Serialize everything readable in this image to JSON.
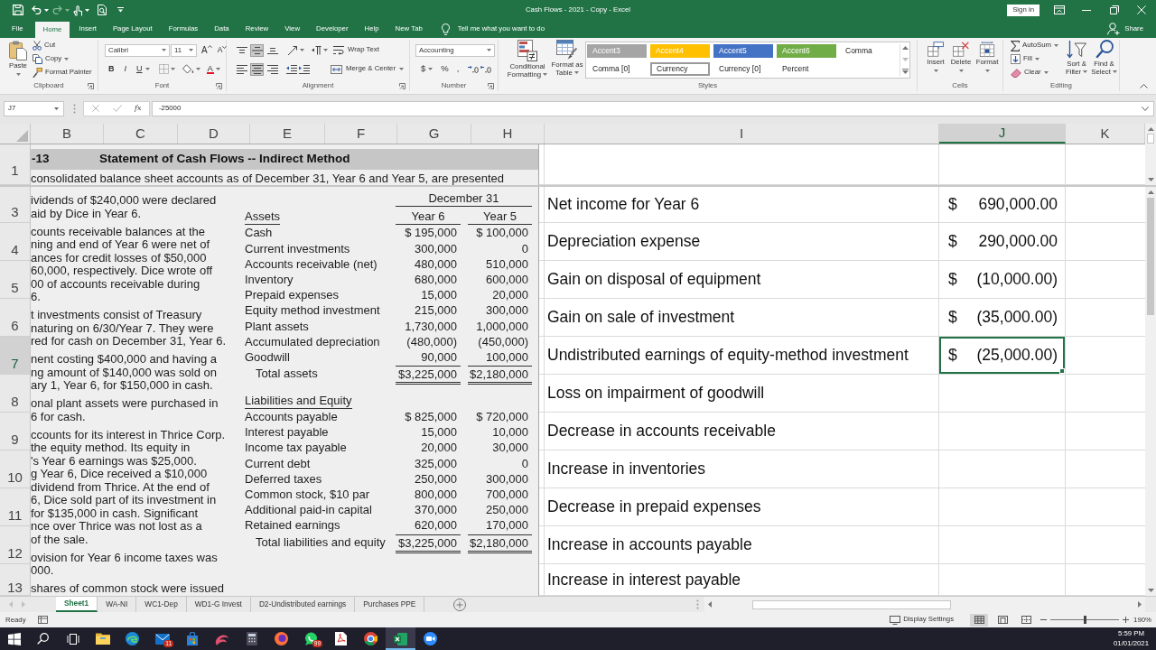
{
  "title_bar": {
    "title": "Cash Flows - 2021 - Copy - Excel",
    "sign_in": "Sign in"
  },
  "quick_access": [
    {
      "kind": "save",
      "disabled": false,
      "dropdown": false
    },
    {
      "kind": "undo",
      "disabled": false,
      "dropdown": true
    },
    {
      "kind": "redo",
      "disabled": true,
      "dropdown": true
    },
    {
      "kind": "touch-mode",
      "disabled": false,
      "dropdown": true
    },
    {
      "kind": "print-preview",
      "disabled": false,
      "dropdown": false
    },
    {
      "kind": "customize",
      "disabled": false,
      "dropdown": false
    }
  ],
  "menu_tabs": [
    {
      "label": "File",
      "selected": false
    },
    {
      "label": "Home",
      "selected": true
    },
    {
      "label": "Insert",
      "selected": false
    },
    {
      "label": "Page Layout",
      "selected": false
    },
    {
      "label": "Formulas",
      "selected": false
    },
    {
      "label": "Data",
      "selected": false
    },
    {
      "label": "Review",
      "selected": false
    },
    {
      "label": "View",
      "selected": false
    },
    {
      "label": "Developer",
      "selected": false
    },
    {
      "label": "Help",
      "selected": false
    },
    {
      "label": "New Tab",
      "selected": false
    }
  ],
  "tell_me": "Tell me what you want to do",
  "share": "Share",
  "ribbon": {
    "clipboard": {
      "label": "Clipboard",
      "paste": "Paste",
      "items": [
        {
          "label": "Cut",
          "kind": "cut",
          "dropdown": false
        },
        {
          "label": "Copy",
          "kind": "copy",
          "dropdown": true
        },
        {
          "label": "Format Painter",
          "kind": "format-painter",
          "dropdown": false
        }
      ]
    },
    "font": {
      "label": "Font",
      "font_name": "Calibri",
      "font_size": "11",
      "grow": "A",
      "shrink": "A",
      "bold": "B",
      "italic": "I",
      "underline": "U",
      "font_color": "A"
    },
    "alignment": {
      "label": "Alignment",
      "vertical": [
        {
          "kind": "top",
          "selected": false
        },
        {
          "kind": "middle",
          "selected": true
        },
        {
          "kind": "bottom",
          "selected": false
        }
      ],
      "horizontal": [
        {
          "kind": "left",
          "selected": false
        },
        {
          "kind": "center",
          "selected": true
        },
        {
          "kind": "right",
          "selected": false
        }
      ],
      "wrap_text": "Wrap Text",
      "merge": "Merge & Center"
    },
    "number": {
      "label": "Number",
      "format": "Accounting",
      "currency": "$",
      "percent": "%",
      "comma": ","
    },
    "styles": {
      "label": "Styles",
      "conditional": "Conditional Formatting",
      "format_table": "Format as Table",
      "cell_styles": [
        {
          "name": "Accent3",
          "color": "#a5a5a5",
          "selected": false
        },
        {
          "name": "Accent4",
          "color": "#ffc000",
          "selected": false
        },
        {
          "name": "Accent5",
          "color": "#4472c4",
          "selected": false
        },
        {
          "name": "Accent6",
          "color": "#70ad47",
          "selected": false
        },
        {
          "name": "Comma",
          "selected": false
        },
        {
          "name": "Comma [0]",
          "selected": false
        },
        {
          "name": "Currency",
          "selected": true
        },
        {
          "name": "Currency [0]",
          "selected": false
        },
        {
          "name": "Percent",
          "selected": false
        }
      ]
    },
    "cells": {
      "label": "Cells",
      "buttons": [
        {
          "label": "Insert",
          "kind": "insert"
        },
        {
          "label": "Delete",
          "kind": "delete"
        },
        {
          "label": "Format",
          "kind": "format"
        }
      ]
    },
    "editing": {
      "label": "Editing",
      "autosum": "AutoSum",
      "fill": "Fill",
      "clear": "Clear",
      "sort": "Sort & Filter",
      "find": "Find & Select"
    }
  },
  "formula_bar": {
    "name_box": "J7",
    "function": "fx",
    "formula": "-25000"
  },
  "columns": [
    {
      "label": "B",
      "selected": false
    },
    {
      "label": "C",
      "selected": false
    },
    {
      "label": "D",
      "selected": false
    },
    {
      "label": "E",
      "selected": false
    },
    {
      "label": "F",
      "selected": false
    },
    {
      "label": "G",
      "selected": false
    },
    {
      "label": "H",
      "selected": false
    },
    {
      "label": "I",
      "selected": false
    },
    {
      "label": "J",
      "selected": true
    },
    {
      "label": "K",
      "selected": false
    }
  ],
  "frozen_rows": [
    {
      "header": "1",
      "selected": false
    }
  ],
  "picture": {
    "number": "-13",
    "title": "Statement of Cash Flows -- Indirect Method",
    "intro": "consolidated balance sheet accounts as of December 31, Year 6 and Year 5, are presented",
    "notes": [
      {
        "lines": [
          "ividends of $240,000 were declared",
          "aid by Dice in Year 6."
        ]
      },
      {
        "lines": [
          "counts receivable balances at the",
          "ning and end of Year 6 were net of",
          "ances for credit losses of $50,000",
          "60,000, respectively. Dice wrote off",
          "00 of accounts receivable during",
          "6."
        ]
      },
      {
        "lines": [
          "t investments consist of Treasury",
          "naturing on 6/30/Year 7. They were",
          "red for cash on December 31, Year 6."
        ]
      },
      {
        "lines": [
          "nent costing $400,000 and having a",
          "ng amount of $140,000 was sold on",
          "ary 1, Year 6, for $150,000 in cash."
        ]
      },
      {
        "lines": [
          "onal plant assets were purchased in",
          "6 for cash."
        ]
      },
      {
        "lines": [
          "ccounts for its interest in Thrice Corp.",
          "the equity method. Its equity in",
          "'s Year 6 earnings was $25,000.",
          "g Year 6, Dice received a $10,000",
          "dividend from Thrice. At the end of",
          "6, Dice sold part of its investment in",
          "for $135,000 in cash. Significant",
          "nce over Thrice was not lost as a",
          "of the sale."
        ]
      },
      {
        "lines": [
          "ovision for Year 6 income taxes was",
          "000."
        ]
      },
      {
        "lines": [
          "shares of common stock were issued"
        ]
      }
    ],
    "balance_sheet": {
      "period": "December 31",
      "years": [
        "Year 6",
        "Year 5"
      ],
      "sections": [
        {
          "heading": "Assets",
          "rows": [
            {
              "label": "Cash",
              "kind": "item",
              "values": [
                "$ 195,000",
                "$ 100,000"
              ]
            },
            {
              "label": "Current investments",
              "kind": "item",
              "values": [
                "300,000",
                "0"
              ]
            },
            {
              "label": "Accounts receivable (net)",
              "kind": "item",
              "values": [
                "480,000",
                "510,000"
              ]
            },
            {
              "label": "Inventory",
              "kind": "item",
              "values": [
                "680,000",
                "600,000"
              ]
            },
            {
              "label": "Prepaid expenses",
              "kind": "item",
              "values": [
                "15,000",
                "20,000"
              ]
            },
            {
              "label": "Equity method investment",
              "kind": "item",
              "values": [
                "215,000",
                "300,000"
              ]
            },
            {
              "label": "Plant assets",
              "kind": "item",
              "values": [
                "1,730,000",
                "1,000,000"
              ]
            },
            {
              "label": "Accumulated depreciation",
              "kind": "item",
              "values": [
                "(480,000)",
                "(450,000)"
              ]
            },
            {
              "label": "Goodwill",
              "kind": "item",
              "values": [
                "90,000",
                "100,000"
              ]
            },
            {
              "label": "Total assets",
              "kind": "total",
              "values": [
                "$3,225,000",
                "$2,180,000"
              ]
            }
          ]
        },
        {
          "heading": "Liabilities and Equity",
          "rows": [
            {
              "label": "Accounts payable",
              "kind": "item",
              "values": [
                "$ 825,000",
                "$ 720,000"
              ]
            },
            {
              "label": "Interest payable",
              "kind": "item",
              "values": [
                "15,000",
                "10,000"
              ]
            },
            {
              "label": "Income tax payable",
              "kind": "item",
              "values": [
                "20,000",
                "30,000"
              ]
            },
            {
              "label": "Current debt",
              "kind": "item",
              "values": [
                "325,000",
                "0"
              ]
            },
            {
              "label": "Deferred taxes",
              "kind": "item",
              "values": [
                "250,000",
                "300,000"
              ]
            },
            {
              "label": "Common stock, $10 par",
              "kind": "item",
              "values": [
                "800,000",
                "700,000"
              ]
            },
            {
              "label": "Additional paid-in capital",
              "kind": "item",
              "values": [
                "370,000",
                "250,000"
              ]
            },
            {
              "label": "Retained earnings",
              "kind": "item",
              "values": [
                "620,000",
                "170,000"
              ]
            },
            {
              "label": "Total liabilities and equity",
              "kind": "total",
              "values": [
                "$3,225,000",
                "$2,180,000"
              ]
            }
          ]
        }
      ]
    }
  },
  "rows": [
    {
      "header": "3",
      "selected": false,
      "item": "Net income for Year 6",
      "currency": "$",
      "amount": "690,000.00"
    },
    {
      "header": "4",
      "selected": false,
      "item": "Depreciation expense",
      "currency": "$",
      "amount": "290,000.00"
    },
    {
      "header": "5",
      "selected": false,
      "item": "Gain on disposal of equipment",
      "currency": "$",
      "amount": "(10,000.00)"
    },
    {
      "header": "6",
      "selected": false,
      "item": "Gain on sale of investment",
      "currency": "$",
      "amount": "(35,000.00)"
    },
    {
      "header": "7",
      "selected": true,
      "item": "Undistributed earnings of equity-method investment",
      "currency": "$",
      "amount": "(25,000.00)"
    },
    {
      "header": "8",
      "selected": false,
      "item": "Loss on impairment of goodwill"
    },
    {
      "header": "9",
      "selected": false,
      "item": "Decrease in accounts receivable"
    },
    {
      "header": "10",
      "selected": false,
      "item": "Increase in inventories"
    },
    {
      "header": "11",
      "selected": false,
      "item": "Decrease in prepaid expenses"
    },
    {
      "header": "12",
      "selected": false,
      "item": "Increase in accounts payable"
    },
    {
      "header": "13",
      "selected": false,
      "item": "Increase in interest payable"
    }
  ],
  "sheet_tabs": [
    {
      "label": "Sheet1",
      "selected": true
    },
    {
      "label": "WA-NI",
      "selected": false
    },
    {
      "label": "WC1-Dep",
      "selected": false
    },
    {
      "label": "WD1-G Invest",
      "selected": false
    },
    {
      "label": "D2-Undistributed earnings",
      "selected": false
    },
    {
      "label": "Purchases PPE",
      "selected": false
    }
  ],
  "status_bar": {
    "status": "Ready",
    "display_settings": "Display Settings",
    "views": [
      {
        "kind": "normal",
        "selected": true
      },
      {
        "kind": "page-layout",
        "selected": false
      },
      {
        "kind": "page-break",
        "selected": false
      }
    ],
    "zoom": {
      "level": 0.5,
      "reading": "190%"
    }
  },
  "taskbar": {
    "apps": [
      {
        "kind": "folder",
        "active": false
      },
      {
        "kind": "browser-wave",
        "active": false
      },
      {
        "kind": "mail",
        "active": false,
        "badge": "11"
      },
      {
        "kind": "shopping-bag",
        "active": false
      },
      {
        "kind": "swirl",
        "active": false
      },
      {
        "kind": "calculator",
        "active": false
      },
      {
        "kind": "browser-fox",
        "active": false
      },
      {
        "kind": "chat",
        "active": false,
        "badge": "99"
      },
      {
        "kind": "pdf",
        "active": false
      },
      {
        "kind": "browser-ring",
        "active": false
      },
      {
        "kind": "spreadsheet",
        "active": true
      },
      {
        "kind": "video-camera",
        "active": false
      }
    ],
    "time": "5:59 PM",
    "date": "01/01/2021"
  }
}
